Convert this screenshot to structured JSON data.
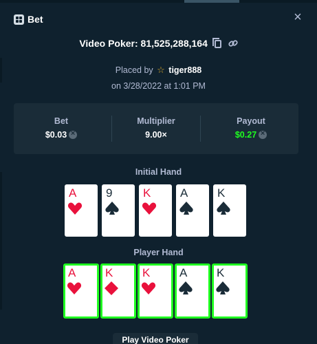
{
  "header": {
    "title": "Bet",
    "close_label": "×"
  },
  "game": {
    "text": "Video Poker: 81,525,288,164"
  },
  "placed": {
    "prefix": "Placed by",
    "username": "tiger888",
    "date": "on 3/28/2022 at 1:01 PM"
  },
  "stats": [
    {
      "label": "Bet",
      "value": "$0.03",
      "has_coin": true,
      "color": "#ffffff"
    },
    {
      "label": "Multiplier",
      "value": "9.00×",
      "has_coin": false,
      "color": "#ffffff"
    },
    {
      "label": "Payout",
      "value": "$0.27",
      "has_coin": true,
      "color": "#1fff20"
    }
  ],
  "initial_hand": {
    "label": "Initial Hand",
    "cards": [
      {
        "rank": "A",
        "suit": "hearts"
      },
      {
        "rank": "9",
        "suit": "spades"
      },
      {
        "rank": "K",
        "suit": "hearts"
      },
      {
        "rank": "A",
        "suit": "spades"
      },
      {
        "rank": "K",
        "suit": "spades"
      }
    ]
  },
  "player_hand": {
    "label": "Player Hand",
    "cards": [
      {
        "rank": "A",
        "suit": "hearts",
        "held": true
      },
      {
        "rank": "K",
        "suit": "diamonds",
        "held": true
      },
      {
        "rank": "K",
        "suit": "hearts",
        "held": true
      },
      {
        "rank": "A",
        "suit": "spades",
        "held": true
      },
      {
        "rank": "K",
        "suit": "spades",
        "held": true
      }
    ]
  },
  "footer": {
    "button_label": "Play Video Poker"
  },
  "colors": {
    "background": "#0f212e",
    "panel": "#1a2c38",
    "accent_green": "#1fff20",
    "red_suit": "#e9113c",
    "star": "#d8a72b"
  }
}
